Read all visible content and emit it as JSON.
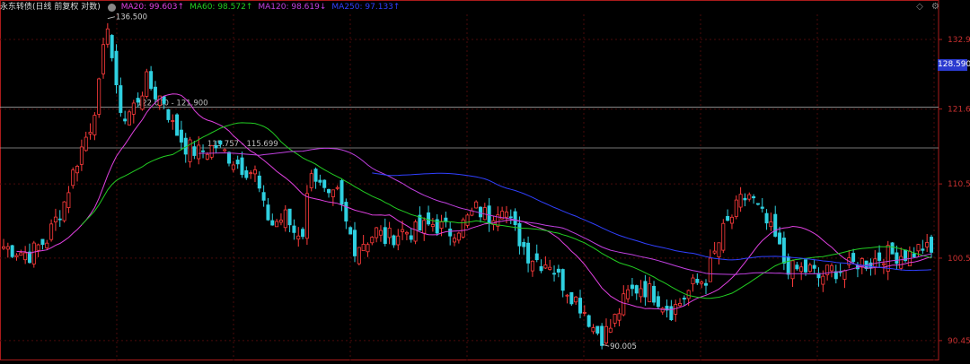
{
  "header": {
    "title": "永东转债(日线 前复权 对数)",
    "indicators": [
      {
        "label": "MA20: 99.603↑",
        "color": "#e040e0"
      },
      {
        "label": "MA60: 98.572↑",
        "color": "#22cc22"
      },
      {
        "label": "MA120: 98.619↓",
        "color": "#c040e0"
      },
      {
        "label": "MA250: 97.133↑",
        "color": "#3040ff"
      }
    ]
  },
  "corner_icons": [
    "diamond-icon",
    "gear-icon"
  ],
  "price_tag": "128.590",
  "chart_data": {
    "type": "candlestick",
    "scale": "log",
    "ylim": [
      90.45,
      134.5
    ],
    "yticks": [
      {
        "value": 132.9,
        "label": "132.9"
      },
      {
        "value": 121.6,
        "label": "121.6"
      },
      {
        "value": 110.5,
        "label": "110.5"
      },
      {
        "value": 100.5,
        "label": "100.5"
      },
      {
        "value": 90.45,
        "label": "90.45"
      }
    ],
    "current_price": 128.59,
    "annotations": [
      {
        "label": "136.500",
        "value": 136.5,
        "kind": "high"
      },
      {
        "label": "90.005",
        "value": 90.005,
        "kind": "low"
      }
    ],
    "levels": [
      {
        "label": "122.000 - 121.900",
        "value": 121.9
      },
      {
        "label": "115.757 - 115.699",
        "value": 115.7
      }
    ],
    "close_path": [
      [
        0,
        102
      ],
      [
        6,
        101
      ],
      [
        10,
        103
      ],
      [
        14,
        108
      ],
      [
        17,
        114
      ],
      [
        20,
        119
      ],
      [
        22,
        125
      ],
      [
        24,
        136
      ],
      [
        26,
        124
      ],
      [
        28,
        120
      ],
      [
        30,
        122
      ],
      [
        33,
        126
      ],
      [
        35,
        124
      ],
      [
        37,
        123
      ],
      [
        39,
        119
      ],
      [
        42,
        116
      ],
      [
        45,
        115
      ],
      [
        49,
        116
      ],
      [
        53,
        114
      ],
      [
        55,
        113
      ],
      [
        58,
        112
      ],
      [
        60,
        107
      ],
      [
        62,
        105
      ],
      [
        65,
        106
      ],
      [
        67,
        104
      ],
      [
        69,
        104
      ],
      [
        71,
        113
      ],
      [
        73,
        110
      ],
      [
        75,
        108
      ],
      [
        77,
        109
      ],
      [
        79,
        105
      ],
      [
        81,
        102
      ],
      [
        84,
        103
      ],
      [
        86,
        104
      ],
      [
        88,
        103
      ],
      [
        92,
        104
      ],
      [
        95,
        104
      ],
      [
        99,
        105
      ],
      [
        103,
        104
      ],
      [
        106,
        105
      ],
      [
        109,
        107
      ],
      [
        112,
        106
      ],
      [
        115,
        108
      ],
      [
        117,
        105
      ],
      [
        119,
        103
      ],
      [
        121,
        101
      ],
      [
        124,
        100
      ],
      [
        126,
        100
      ],
      [
        128,
        98
      ],
      [
        131,
        96
      ],
      [
        134,
        94
      ],
      [
        136,
        92
      ],
      [
        138,
        91
      ],
      [
        140,
        92
      ],
      [
        142,
        94
      ],
      [
        144,
        96
      ],
      [
        147,
        97
      ],
      [
        150,
        96
      ],
      [
        152,
        95
      ],
      [
        154,
        94
      ],
      [
        156,
        95
      ],
      [
        159,
        97
      ],
      [
        162,
        98
      ],
      [
        164,
        101
      ],
      [
        166,
        104
      ],
      [
        168,
        106
      ],
      [
        170,
        108
      ],
      [
        172,
        109
      ],
      [
        174,
        107
      ],
      [
        176,
        105
      ],
      [
        178,
        103
      ],
      [
        180,
        100
      ],
      [
        182,
        99
      ],
      [
        184,
        99
      ],
      [
        186,
        99
      ],
      [
        188,
        98
      ],
      [
        191,
        99
      ],
      [
        194,
        99
      ],
      [
        197,
        100
      ],
      [
        200,
        100
      ],
      [
        203,
        101
      ],
      [
        206,
        101
      ],
      [
        209,
        101
      ],
      [
        212,
        102
      ],
      [
        214,
        101
      ]
    ],
    "ma_series": [
      {
        "name": "MA20",
        "color": "#e040e0"
      },
      {
        "name": "MA60",
        "color": "#22cc22"
      },
      {
        "name": "MA120",
        "color": "#c040e0"
      },
      {
        "name": "MA250",
        "color": "#3040ff"
      }
    ],
    "colors": {
      "up": "#ff3b3b",
      "down": "#2fd0e0",
      "grid": "#4a0a0a",
      "axis": "#aa1b1b",
      "level": "#9a9a9a"
    }
  }
}
